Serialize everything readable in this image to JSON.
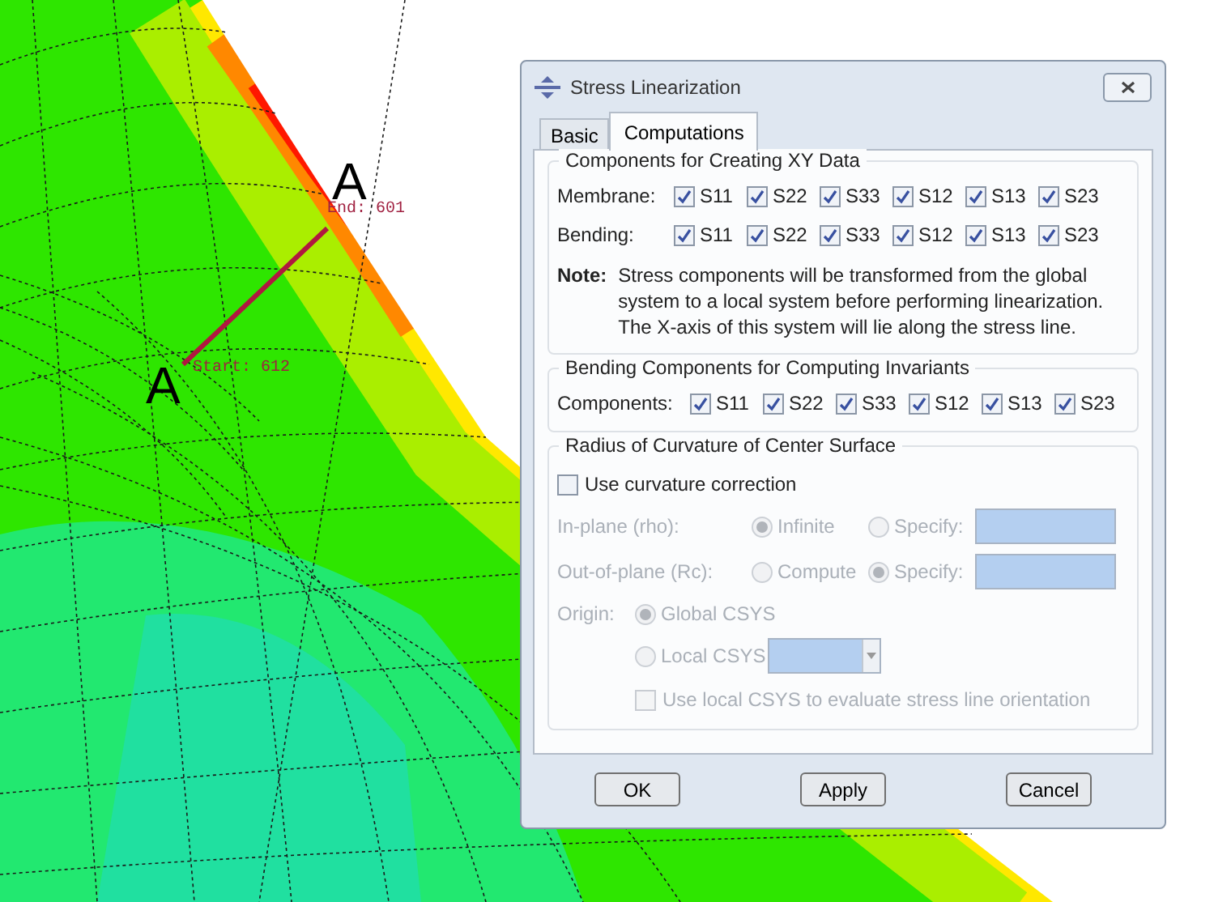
{
  "viewport": {
    "labels": [
      {
        "kind": "letter",
        "text": "A"
      },
      {
        "kind": "point",
        "text": "End: 601"
      },
      {
        "kind": "letter",
        "text": "A"
      },
      {
        "kind": "point",
        "text": "Start: 612"
      }
    ]
  },
  "window": {
    "title": "Stress Linearization"
  },
  "tabs": [
    {
      "label": "Basic",
      "selected": false
    },
    {
      "label": "Computations",
      "selected": true
    }
  ],
  "xy_group": {
    "title": "Components for Creating XY Data",
    "rows": [
      {
        "label": "Membrane:",
        "items": [
          {
            "label": "S11",
            "checked": true
          },
          {
            "label": "S22",
            "checked": true
          },
          {
            "label": "S33",
            "checked": true
          },
          {
            "label": "S12",
            "checked": true
          },
          {
            "label": "S13",
            "checked": true
          },
          {
            "label": "S23",
            "checked": true
          }
        ]
      },
      {
        "label": "Bending:",
        "items": [
          {
            "label": "S11",
            "checked": true
          },
          {
            "label": "S22",
            "checked": true
          },
          {
            "label": "S33",
            "checked": true
          },
          {
            "label": "S12",
            "checked": true
          },
          {
            "label": "S13",
            "checked": true
          },
          {
            "label": "S23",
            "checked": true
          }
        ]
      }
    ],
    "note_label": "Note:",
    "note": "Stress components will be transformed from the global system to a local system before performing linearization. The X-axis of this system will lie along the stress line."
  },
  "invariants_group": {
    "title": "Bending Components for Computing Invariants",
    "label": "Components:",
    "items": [
      {
        "label": "S11",
        "checked": true
      },
      {
        "label": "S22",
        "checked": true
      },
      {
        "label": "S33",
        "checked": true
      },
      {
        "label": "S12",
        "checked": true
      },
      {
        "label": "S13",
        "checked": true
      },
      {
        "label": "S23",
        "checked": true
      }
    ]
  },
  "curvature_group": {
    "title": "Radius of Curvature of Center Surface",
    "use_correction": {
      "label": "Use curvature correction",
      "checked": false
    },
    "in_plane": {
      "label": "In-plane (rho):",
      "options": [
        {
          "label": "Infinite",
          "selected": true
        },
        {
          "label": "Specify:",
          "selected": false
        }
      ],
      "disabled": true
    },
    "out_of_plane": {
      "label": "Out-of-plane (Rc):",
      "options": [
        {
          "label": "Compute",
          "selected": false
        },
        {
          "label": "Specify:",
          "selected": true
        }
      ],
      "disabled": true
    },
    "origin": {
      "label": "Origin:",
      "options": [
        {
          "label": "Global CSYS",
          "selected": true
        },
        {
          "label": "Local CSYS",
          "selected": false
        }
      ],
      "disabled": true
    },
    "use_local": {
      "label": "Use local CSYS to evaluate stress line orientation",
      "checked": false,
      "disabled": true
    }
  },
  "buttons": [
    "OK",
    "Apply",
    "Cancel"
  ]
}
